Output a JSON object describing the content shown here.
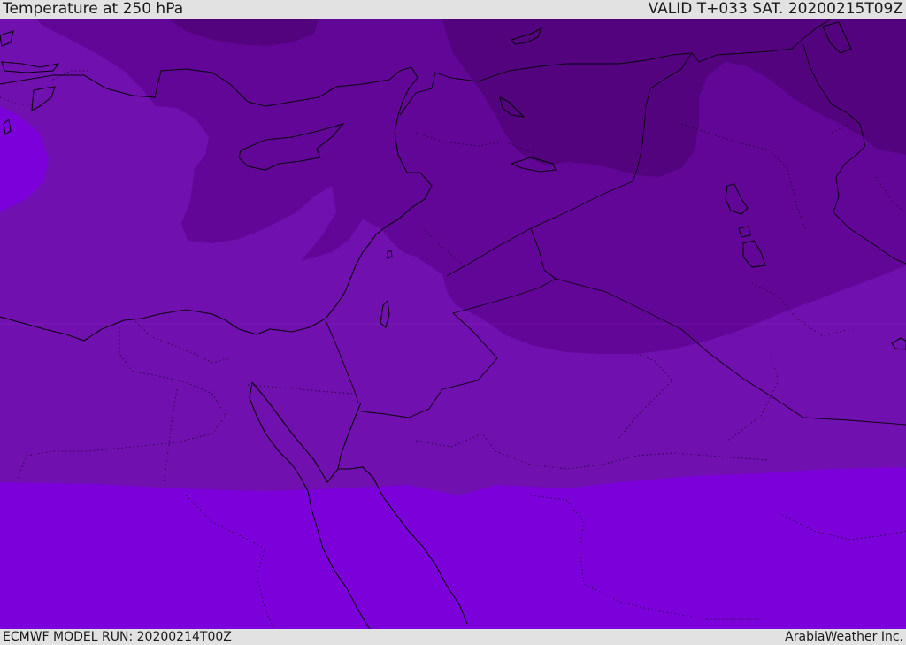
{
  "header": {
    "title": "Temperature at 250 hPa",
    "valid": "VALID T+033 SAT. 20200215T09Z"
  },
  "footer": {
    "model_run": "ECMWF MODEL RUN: 20200214T00Z",
    "credit": "ArabiaWeather Inc."
  },
  "colors": {
    "band_coldest": "#52037d",
    "band_cold": "#620697",
    "band_mid": "#7010ae",
    "band_warm": "#7b00d9",
    "coastline": "#0a0010",
    "border": "#0a0010",
    "bar_background": "#e2e2e2"
  }
}
